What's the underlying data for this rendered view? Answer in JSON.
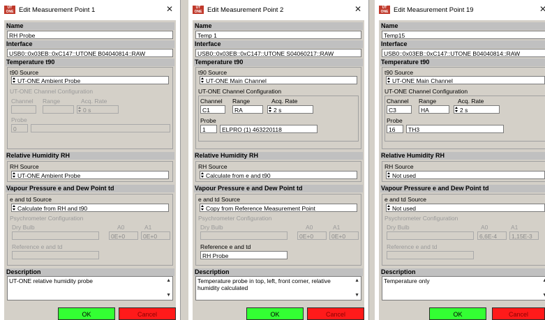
{
  "dialogs": [
    {
      "title": "Edit Measurement Point 1",
      "name_label": "Name",
      "name_value": "RH Probe",
      "interface_label": "Interface",
      "interface_value": "USB0::0x03EB::0xC147::UTONE B04040814::RAW",
      "t90_label": "Temperature t90",
      "t90_source_label": "t90 Source",
      "t90_source_value": "UT-ONE Ambient Probe",
      "channel_config_label": "UT-ONE Channel Configuration",
      "channel_label": "Channel",
      "range_label": "Range",
      "acq_rate_label": "Acq. Rate",
      "channel_value": "",
      "range_value": "",
      "acq_rate_value": "0 s",
      "probe_label": "Probe",
      "probe_number": "0",
      "probe_name": "",
      "rh_label": "Relative Humidity RH",
      "rh_source_label": "RH Source",
      "rh_source_value": "UT-ONE Ambient Probe",
      "vp_label": "Vapour Pressure e and Dew Point td",
      "etd_source_label": "e and td Source",
      "etd_source_value": "Calculate from RH and t90",
      "psy_label": "Psychrometer Configuration",
      "dry_bulb_label": "Dry Bulb",
      "a0_label": "A0",
      "a1_label": "A1",
      "dry_bulb_value": "",
      "a0_value": "0E+0",
      "a1_value": "0E+0",
      "ref_label": "Reference e and td",
      "ref_value": "",
      "desc_label": "Description",
      "desc_value": "UT-ONE relative humidity probe",
      "ok_label": "OK",
      "cancel_label": "Cancel"
    },
    {
      "title": "Edit Measurement Point 2",
      "name_label": "Name",
      "name_value": "Temp 1",
      "interface_label": "Interface",
      "interface_value": "USB0::0x03EB::0xC147::UTONE S04060217::RAW",
      "t90_label": "Temperature t90",
      "t90_source_label": "t90 Source",
      "t90_source_value": "UT-ONE Main Channel",
      "channel_config_label": "UT-ONE Channel Configuration",
      "channel_label": "Channel",
      "range_label": "Range",
      "acq_rate_label": "Acq. Rate",
      "channel_value": "C1",
      "range_value": "RA",
      "acq_rate_value": "2 s",
      "probe_label": "Probe",
      "probe_number": "1",
      "probe_name": "ELPRO (1) 463220118",
      "rh_label": "Relative Humidity RH",
      "rh_source_label": "RH Source",
      "rh_source_value": "Calculate from e and t90",
      "vp_label": "Vapour Pressure e and Dew Point td",
      "etd_source_label": "e and td Source",
      "etd_source_value": "Copy from Reference Measurement Point",
      "psy_label": "Psychrometer Configuration",
      "dry_bulb_label": "Dry Bulb",
      "a0_label": "A0",
      "a1_label": "A1",
      "dry_bulb_value": "",
      "a0_value": "0E+0",
      "a1_value": "0E+0",
      "ref_label": "Reference e and td",
      "ref_value": "RH Probe",
      "desc_label": "Description",
      "desc_value": "Temperature probe in top, left, front corner, relative humidity calculated",
      "ok_label": "OK",
      "cancel_label": "Cancel"
    },
    {
      "title": "Edit Measurement Point 19",
      "name_label": "Name",
      "name_value": "Temp15",
      "interface_label": "Interface",
      "interface_value": "USB0::0x03EB::0xC147::UTONE B04040814::RAW",
      "t90_label": "Temperature t90",
      "t90_source_label": "t90 Source",
      "t90_source_value": "UT-ONE Main Channel",
      "channel_config_label": "UT-ONE Channel Configuration",
      "channel_label": "Channel",
      "range_label": "Range",
      "acq_rate_label": "Acq. Rate",
      "channel_value": "C3",
      "range_value": "HA",
      "acq_rate_value": "2 s",
      "probe_label": "Probe",
      "probe_number": "16",
      "probe_name": "TH3",
      "rh_label": "Relative Humidity RH",
      "rh_source_label": "RH Source",
      "rh_source_value": "Not used",
      "vp_label": "Vapour Pressure e and Dew Point td",
      "etd_source_label": "e and td Source",
      "etd_source_value": "Not used",
      "psy_label": "Psychrometer Configuration",
      "dry_bulb_label": "Dry Bulb",
      "a0_label": "A0",
      "a1_label": "A1",
      "dry_bulb_value": "",
      "a0_value": "6,6E-4",
      "a1_value": "1,15E-3",
      "ref_label": "Reference e and td",
      "ref_value": "",
      "desc_label": "Description",
      "desc_value": "Temperature only",
      "ok_label": "OK",
      "cancel_label": "Cancel"
    }
  ],
  "app_icon_text": "UT ONE",
  "close_icon": "close-icon",
  "colors": {
    "ok": "#33ff33",
    "cancel": "#ff1a1a",
    "section": "#c0c0c0",
    "panel": "#d4d0c8"
  }
}
